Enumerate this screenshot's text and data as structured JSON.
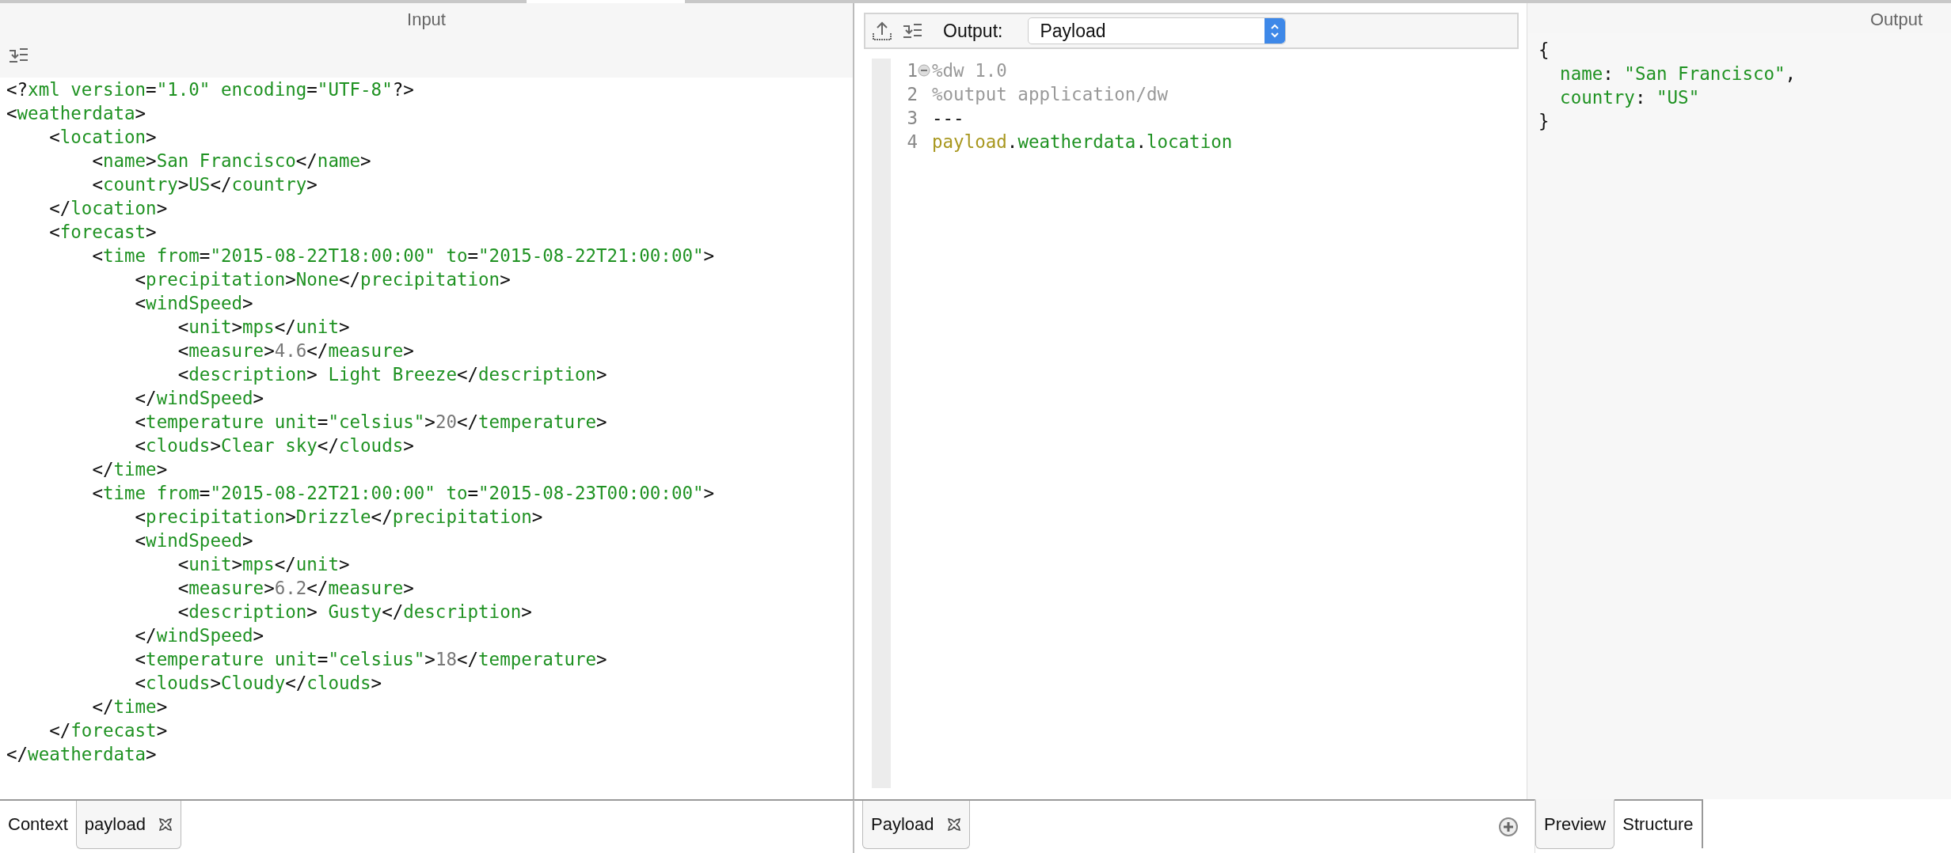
{
  "input_panel": {
    "title": "Input",
    "code_lines": [
      "<?xml version=\"1.0\" encoding=\"UTF-8\"?>",
      "<weatherdata>",
      "    <location>",
      "        <name>San Francisco</name>",
      "        <country>US</country>",
      "    </location>",
      "    <forecast>",
      "        <time from=\"2015-08-22T18:00:00\" to=\"2015-08-22T21:00:00\">",
      "            <precipitation>None</precipitation>",
      "            <windSpeed>",
      "                <unit>mps</unit>",
      "                <measure>4.6</measure>",
      "                <description> Light Breeze</description>",
      "            </windSpeed>",
      "            <temperature unit=\"celsius\">20</temperature>",
      "            <clouds>Clear sky</clouds>",
      "        </time>",
      "        <time from=\"2015-08-22T21:00:00\" to=\"2015-08-23T00:00:00\">",
      "            <precipitation>Drizzle</precipitation>",
      "            <windSpeed>",
      "                <unit>mps</unit>",
      "                <measure>6.2</measure>",
      "                <description> Gusty</description>",
      "            </windSpeed>",
      "            <temperature unit=\"celsius\">18</temperature>",
      "            <clouds>Cloudy</clouds>",
      "        </time>",
      "    </forecast>",
      "</weatherdata>"
    ],
    "tabs": [
      {
        "label": "Context",
        "selected": false,
        "closable": false
      },
      {
        "label": "payload",
        "selected": true,
        "closable": true
      }
    ]
  },
  "script_panel": {
    "output_label": "Output:",
    "output_select": "Payload",
    "code_lines": [
      {
        "number": "1",
        "foldable": true,
        "segments": [
          {
            "text": "%dw 1.0",
            "kind": "directive"
          }
        ]
      },
      {
        "number": "2",
        "foldable": false,
        "segments": [
          {
            "text": "%output application/dw",
            "kind": "directive"
          }
        ]
      },
      {
        "number": "3",
        "foldable": false,
        "segments": [
          {
            "text": "---",
            "kind": "punct"
          }
        ]
      },
      {
        "number": "4",
        "foldable": false,
        "segments": [
          {
            "text": "payload",
            "kind": "keyword"
          },
          {
            "text": ".weatherdata.location",
            "kind": "member_path"
          }
        ]
      }
    ],
    "tabs": [
      {
        "label": "Payload",
        "selected": true,
        "closable": true
      }
    ]
  },
  "output_panel": {
    "title": "Output",
    "code_lines": [
      "{",
      "  name: \"San Francisco\",",
      "  country: \"US\"",
      "}"
    ],
    "tabs": [
      {
        "label": "Preview",
        "selected": true
      },
      {
        "label": "Structure",
        "selected": false
      }
    ]
  }
}
